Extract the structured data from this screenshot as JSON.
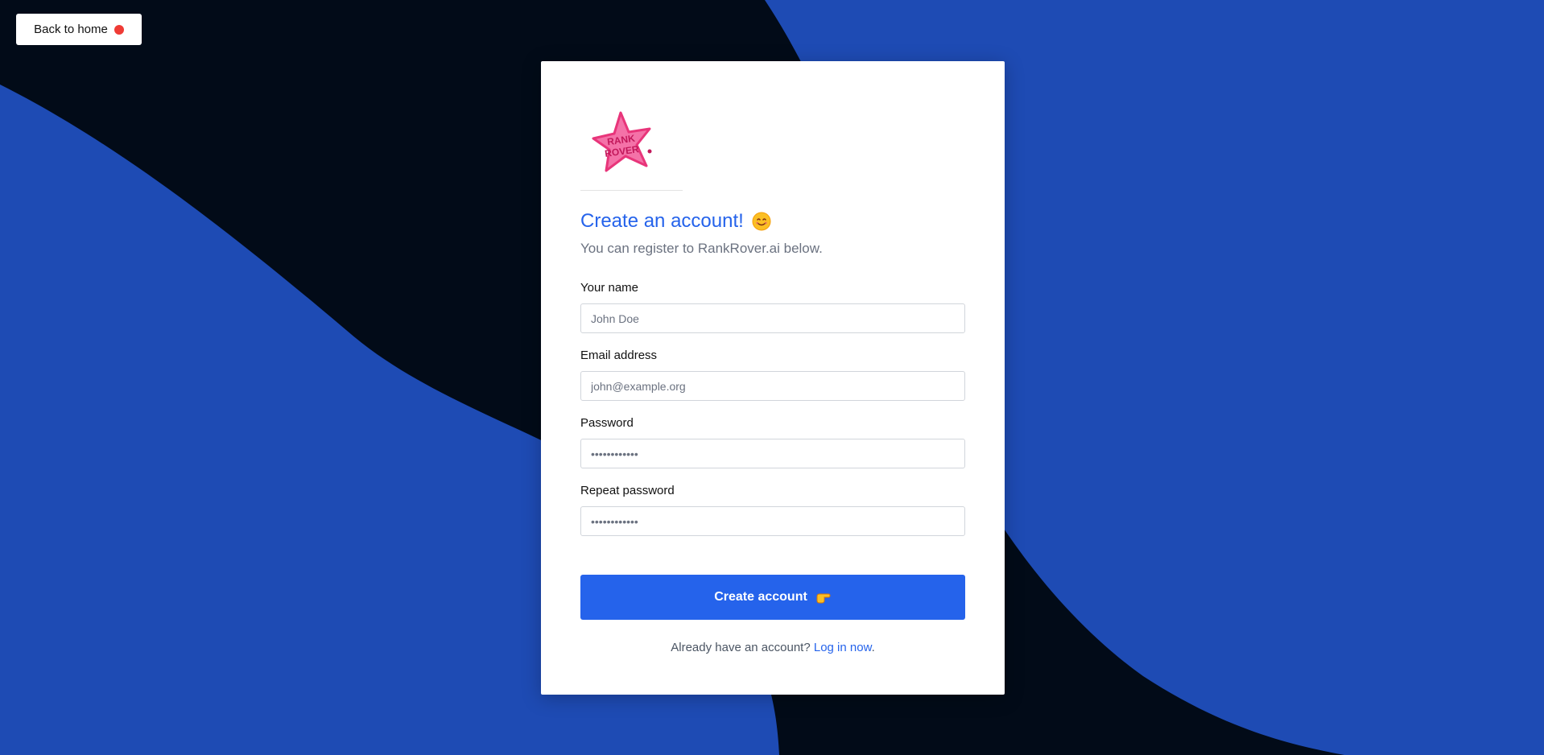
{
  "colors": {
    "background_blue": "#1e4bb4",
    "background_dark": "#020b18",
    "accent": "#2563eb",
    "danger_dot": "#ef3b35",
    "logo_pink": "#e8357a"
  },
  "nav": {
    "back_label": "Back to home",
    "status_icon": "red-dot-icon"
  },
  "brand": {
    "logo_text": "RANK ROVER"
  },
  "form": {
    "title": "Create an account!",
    "title_icon": "smiley-emoji-icon",
    "subtitle": "You can register to RankRover.ai below.",
    "fields": [
      {
        "label": "Your name",
        "placeholder": "John Doe",
        "type": "text"
      },
      {
        "label": "Email address",
        "placeholder": "john@example.org",
        "type": "email"
      },
      {
        "label": "Password",
        "placeholder": "••••••••••••",
        "type": "password"
      },
      {
        "label": "Repeat password",
        "placeholder": "••••••••••••",
        "type": "password"
      }
    ],
    "submit_label": "Create account",
    "submit_icon": "pointing-hand-icon",
    "footer_text": "Already have an account?",
    "footer_link": "Log in now",
    "footer_end": "."
  }
}
